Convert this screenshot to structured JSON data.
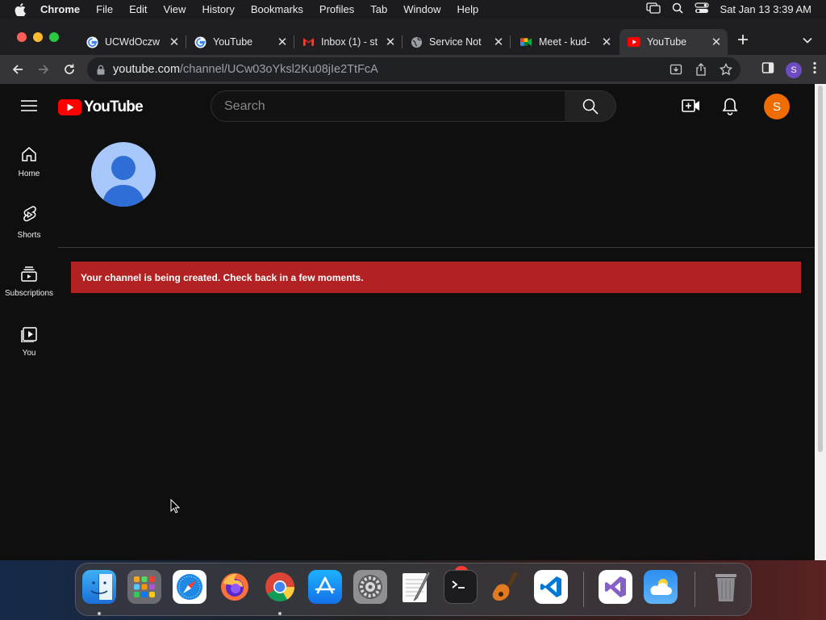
{
  "menubar": {
    "app": "Chrome",
    "items": [
      "File",
      "Edit",
      "View",
      "History",
      "Bookmarks",
      "Profiles",
      "Tab",
      "Window",
      "Help"
    ],
    "datetime": "Sat Jan 13  3:39 AM"
  },
  "tabs": [
    {
      "title": "UCWdOczw",
      "favicon": "google-g-icon"
    },
    {
      "title": "YouTube",
      "favicon": "google-g-icon"
    },
    {
      "title": "Inbox (1) - st",
      "favicon": "gmail-icon"
    },
    {
      "title": "Service Not",
      "favicon": "globe-icon"
    },
    {
      "title": "Meet - kud-",
      "favicon": "meet-icon"
    },
    {
      "title": "YouTube",
      "favicon": "youtube-icon",
      "active": true
    }
  ],
  "address": {
    "domain": "youtube.com",
    "path": "/channel/UCw03oYksl2Ku08jIe2TtFcA"
  },
  "browser_profile_initial": "S",
  "youtube": {
    "logo_text": "YouTube",
    "search_placeholder": "Search",
    "avatar_initial": "S",
    "guide": [
      {
        "label": "Home",
        "icon": "home-icon"
      },
      {
        "label": "Shorts",
        "icon": "shorts-icon"
      },
      {
        "label": "Subscriptions",
        "icon": "subscriptions-icon"
      },
      {
        "label": "You",
        "icon": "you-icon"
      }
    ],
    "alert": "Your channel is being created. Check back in a few moments."
  },
  "dock": {
    "apps": [
      "Finder",
      "Launchpad",
      "Safari",
      "Firefox",
      "Chrome",
      "App Store",
      "System Settings",
      "TextEdit",
      "Terminal",
      "GarageBand",
      "Visual Studio Code",
      "Visual Studio",
      "Weather",
      "Trash"
    ],
    "settings_badge": "1"
  },
  "colors": {
    "yt_red": "#ff0000",
    "alert_bg": "#b22222",
    "avatar": "#ef6c00"
  }
}
